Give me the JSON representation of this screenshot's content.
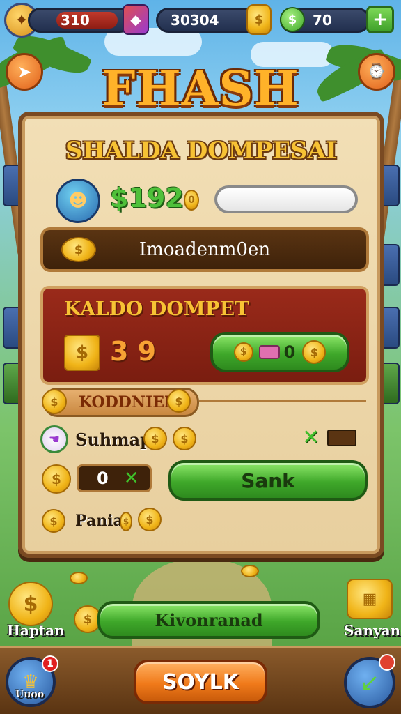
{
  "hud": {
    "health_value": "310",
    "coins_value": "30304",
    "gems_value": "70",
    "add_label": "+"
  },
  "game_title": "FHASH",
  "panel": {
    "title": "SHALDA DOMPESAI",
    "balance_value": "$192",
    "balance_suffix": "0",
    "info_label": "Imoadenm0en",
    "saldo": {
      "title": "KALDO DOMPET",
      "amount": "3 9",
      "button_value": "0"
    },
    "section_tag": "KODDNIEN",
    "row1_label": "Suhmap",
    "row2_value": "0",
    "row2_button": "Sank",
    "row3_label": "Pania"
  },
  "bottom": {
    "wide_button": "Kivonranad",
    "left_caption": "Haptan",
    "right_caption": "Sanyan",
    "main_button": "SOYLK",
    "corner_caption": "Uuoo",
    "badge_count": "1"
  },
  "colors": {
    "title_gold": "#ffb229",
    "panel_bg": "#f2dfb6",
    "panel_border": "#7a4a22",
    "saldo_red": "#9a2a1a",
    "action_green": "#3fa82a",
    "cta_orange": "#f07a1a",
    "hud_navy": "#22304f"
  }
}
